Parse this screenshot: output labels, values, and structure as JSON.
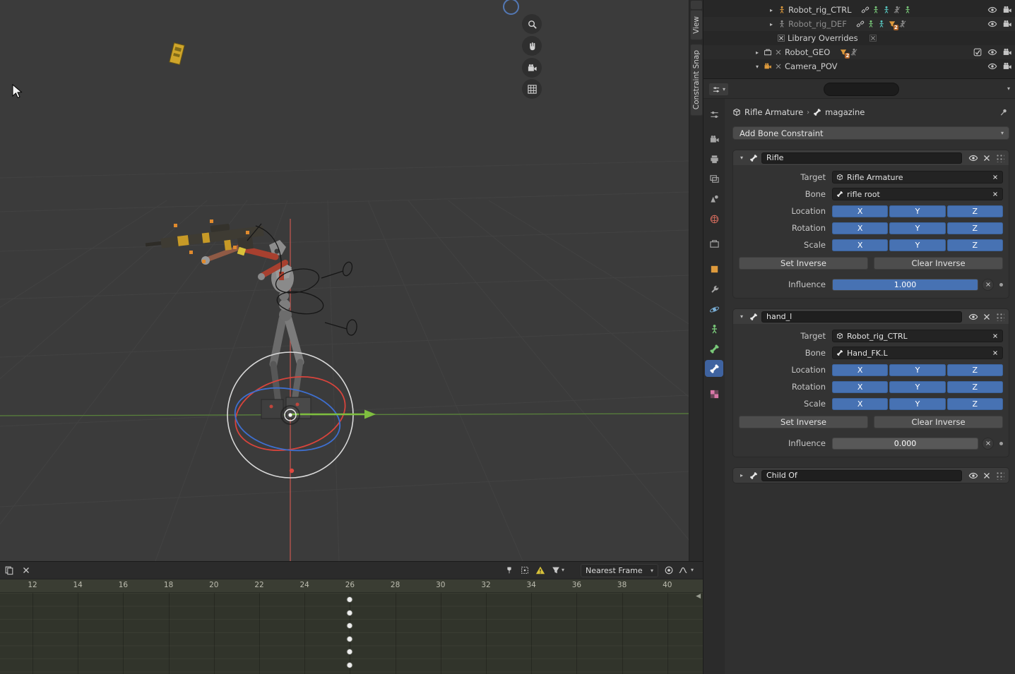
{
  "icons": {
    "search": "magnifier",
    "pin": "pushpin",
    "visibility": "eye",
    "render_toggle": "camera",
    "filter": "funnel",
    "warning": "triangle-exclaim"
  },
  "viewport": {
    "sidebar_tabs": [
      "View",
      "Constraint Snap"
    ]
  },
  "outliner": {
    "rows": [
      {
        "label": "Robot_rig_CTRL"
      },
      {
        "label": "Robot_rig_DEF"
      },
      {
        "label": "Library Overrides"
      },
      {
        "label": "Robot_GEO"
      },
      {
        "label": "Camera_POV"
      }
    ],
    "filter_badge": "2"
  },
  "properties": {
    "search_placeholder": "",
    "breadcrumb": {
      "object": "Rifle Armature",
      "separator": "›",
      "bone": "magazine"
    },
    "add_button": "Add Bone Constraint",
    "labels": {
      "target": "Target",
      "bone": "Bone",
      "location": "Location",
      "rotation": "Rotation",
      "scale": "Scale",
      "influence": "Influence",
      "set_inverse": "Set Inverse",
      "clear_inverse": "Clear Inverse"
    },
    "axes": [
      "X",
      "Y",
      "Z"
    ],
    "constraints": [
      {
        "name": "Rifle",
        "target": "Rifle Armature",
        "bone": "rifle root",
        "influence": "1.000",
        "influence_fill": 1
      },
      {
        "name": "hand_l",
        "target": "Robot_rig_CTRL",
        "bone": "Hand_FK.L",
        "influence": "0.000",
        "influence_fill": 0
      },
      {
        "name": "Child Of"
      }
    ]
  },
  "timeline": {
    "frames": [
      12,
      14,
      16,
      18,
      20,
      22,
      24,
      26,
      28,
      30,
      32,
      34,
      36,
      38,
      40
    ],
    "keyframe_frame": 26,
    "keyframe_rows": 6,
    "snap_mode": "Nearest Frame"
  }
}
